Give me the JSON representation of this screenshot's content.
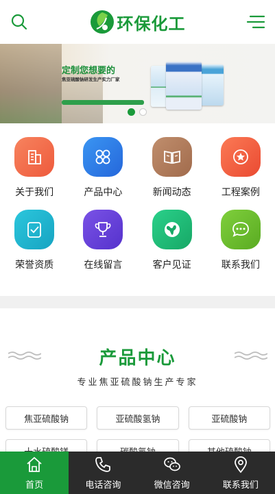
{
  "header": {
    "logo_text": "环保化工",
    "brand_color": "#1a9a3a",
    "search_icon": "search-icon",
    "menu_icon": "menu-icon"
  },
  "banner": {
    "headline": "定制您想要的",
    "subheadline": "焦亚硫酸钠研发生产实力厂家",
    "active_slide": 1,
    "slide_count": 2
  },
  "grid": [
    {
      "label": "关于我们",
      "icon": "building-icon",
      "color": "#f26b4a"
    },
    {
      "label": "产品中心",
      "icon": "grid-icon",
      "color": "#2f7fe6"
    },
    {
      "label": "新闻动态",
      "icon": "book-icon",
      "color": "#b07a5a"
    },
    {
      "label": "工程案例",
      "icon": "badge-icon",
      "color": "#f1593f"
    },
    {
      "label": "荣誉资质",
      "icon": "checklist-icon",
      "color": "#1cb7cf"
    },
    {
      "label": "在线留言",
      "icon": "trophy-icon",
      "color": "#6a43d8"
    },
    {
      "label": "客户见证",
      "icon": "globe-icon",
      "color": "#1fbf76"
    },
    {
      "label": "联系我们",
      "icon": "chat-icon",
      "color": "#6bbf2f"
    }
  ],
  "section": {
    "title": "产品中心",
    "subtitle": "专业焦亚硫酸钠生产专家"
  },
  "categories": [
    {
      "label": "焦亚硫酸钠"
    },
    {
      "label": "亚硫酸氢钠"
    },
    {
      "label": "亚硫酸钠"
    },
    {
      "label": "十水硫酸镁"
    },
    {
      "label": "碳酸氢钠"
    },
    {
      "label": "其他硫酸钠"
    }
  ],
  "bottom_nav": [
    {
      "label": "首页",
      "icon": "home-icon",
      "active": true
    },
    {
      "label": "电话咨询",
      "icon": "phone-icon",
      "active": false
    },
    {
      "label": "微信咨询",
      "icon": "wechat-icon",
      "active": false
    },
    {
      "label": "联系我们",
      "icon": "location-icon",
      "active": false
    }
  ]
}
